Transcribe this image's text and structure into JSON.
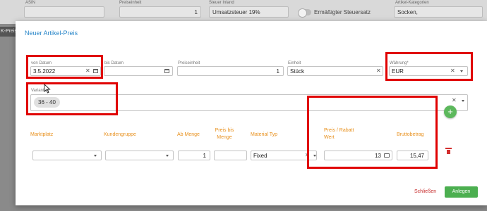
{
  "background": {
    "labels": {
      "asin": "ASIN",
      "unit": "Preiseinheit",
      "tax": "Steuer Inland",
      "categories": "Artikel-Kategorien"
    },
    "unit_value": "1",
    "tax_value": "Umsatzsteuer 19%",
    "reduced_tax_label": "Ermäßigter Steuersatz",
    "categories_value": "Socken,",
    "side_tab": "K-Preis"
  },
  "modal": {
    "title": "Neuer Artikel-Preis",
    "fields": {
      "from_date": {
        "label": "von Datum",
        "value": "3.5.2022"
      },
      "to_date": {
        "label": "bis Datum",
        "value": ""
      },
      "price_unit": {
        "label": "Preiseinheit",
        "value": "1"
      },
      "unit": {
        "label": "Einheit",
        "value": "Stück"
      },
      "currency": {
        "label": "Währung*",
        "value": "EUR"
      },
      "variants": {
        "label": "Varianten",
        "chip": "36 - 40"
      }
    },
    "table": {
      "headers": {
        "marketplace": "Marktplatz",
        "customer_group": "Kundengruppe",
        "from_qty": "Ab Menge",
        "to_qty": "Preis bis Menge",
        "material_type": "Material Typ",
        "price_discount": "Preis / Rabatt Wert",
        "gross": "Bruttobetrag"
      },
      "row": {
        "marketplace": "",
        "customer_group": "",
        "from_qty": "1",
        "to_qty": "",
        "material_type": "Fixed",
        "price_discount": "13",
        "gross": "15,47"
      }
    },
    "buttons": {
      "close": "Schließen",
      "create": "Anlegen"
    }
  },
  "colors": {
    "accent": "#2a87c9",
    "orange": "#e8901c",
    "green": "#4caf50",
    "red": "#e00000"
  }
}
